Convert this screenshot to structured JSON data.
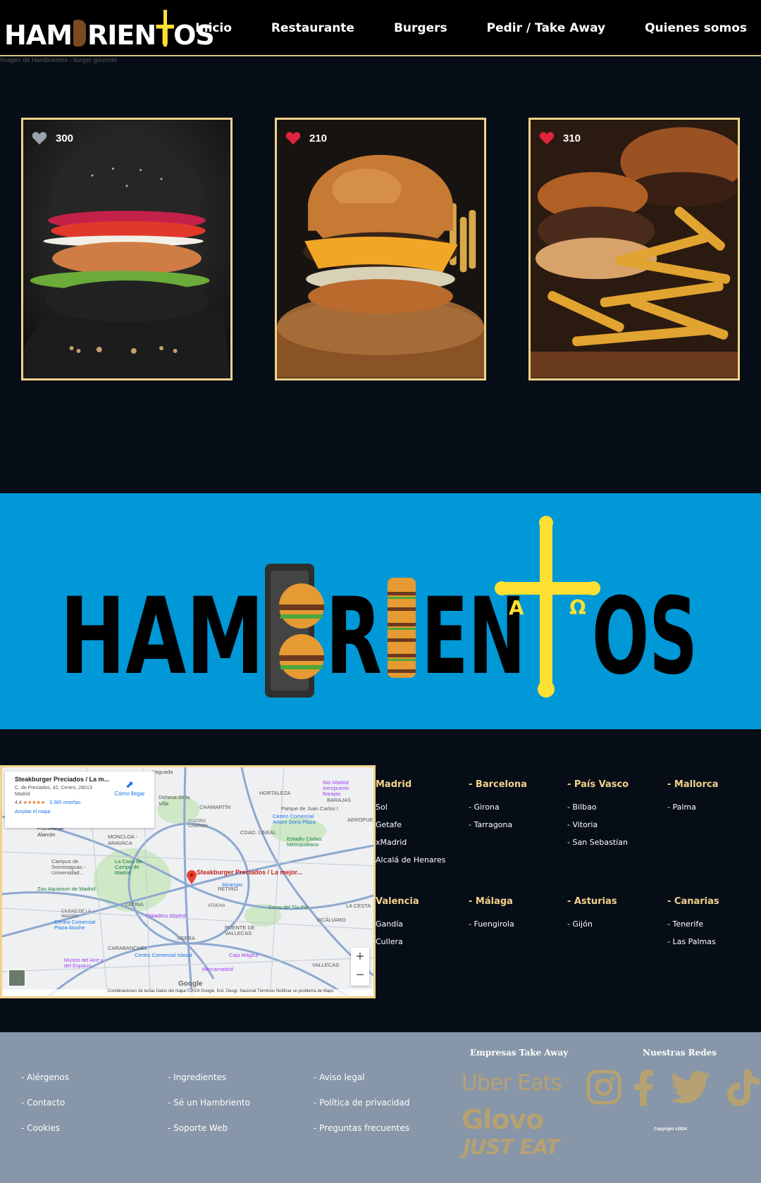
{
  "header": {
    "logo_text": "HAMBRIENTOS",
    "logo_parts": [
      "HAM",
      "RIEN",
      "OS"
    ],
    "nav": [
      "Inicio",
      "Restaurante",
      "Burgers",
      "Pedir / Take Away",
      "Quienes somos"
    ]
  },
  "broken_image_alt": "Imagen de Hambrientos - burger gourmet",
  "cards": [
    {
      "likes": "300",
      "heart": "gray-heart-icon",
      "color": "#9aa3ad"
    },
    {
      "likes": "210",
      "heart": "red-heart-icon",
      "color": "#e0243d"
    },
    {
      "likes": "310",
      "heart": "red-heart-icon",
      "color": "#e0243d"
    }
  ],
  "banner": {
    "logo_parts": [
      "HAM",
      "RIEN",
      "OS"
    ],
    "bg_color": "#0098d6",
    "cross_color": "#ffe033"
  },
  "map": {
    "place_name": "Steakburger Preciados / La m...",
    "address": "C. de Preciados, 42, Centro, 28013 Madrid",
    "rating": "4,4",
    "stars": "★★★★★",
    "reviews": "3.380 reseñas",
    "enlarge": "Ampliar el mapa",
    "directions": "Cómo llegar",
    "pin_label": "Steakburger Preciados / La mejor...",
    "credits": "Combinaciones de teclas   Datos del mapa ©2024 Google, Inst. Geogr. Nacional   Términos   Notificar un problema de Maps",
    "google": "Google",
    "zoom_in": "+",
    "zoom_out": "−",
    "places": [
      "Vaguada",
      "HORTALEZA",
      "Ibis Madrid Aeropuerto Barajas",
      "BARAJAS",
      "Parque de Juan Carlos I",
      "CHAMARTÍN",
      "Dehesa de la Villa",
      "Pozuelo de Alarcón",
      "MONCLOA - ARAVACA",
      "Centro Comercial Arturo Soria Plaza",
      "CDAD. LINEAL",
      "Estadio Civitas Metropolitano",
      "Campus de Somosaguas - Universidad...",
      "La Casa de Campo de Madrid",
      "Zoo Aquarium de Madrid",
      "LATINA",
      "Matadero Madrid",
      "Alcampo",
      "Cerro del Tío Pío",
      "VICÁLVARO",
      "LA CESTA",
      "Centro Comercial Plaza Aluche",
      "USERA",
      "PUENTE DE VALLECAS",
      "CARABANCHEL",
      "Museo del Aire y del Espacio",
      "Centro Comercial Islazul",
      "Caja Mágica",
      "VALLECAS",
      "Mercamadrid",
      "RETIRO",
      "AEROPUERT",
      "CUATRO CAMINOS",
      "CIUDAD DE LA IMAGEN",
      "ATOCHA"
    ]
  },
  "cities": [
    {
      "region": "Madrid",
      "items": [
        "Sol",
        "Getafe",
        "xMadrid",
        "Alcalá de Henares"
      ]
    },
    {
      "region": "- Barcelona",
      "items": [
        "- Girona",
        "- Tarragona"
      ]
    },
    {
      "region": "- País Vasco",
      "items": [
        "- Bilbao",
        "- Vitoria",
        "- San Sebastían"
      ]
    },
    {
      "region": "- Mallorca",
      "items": [
        "- Palma"
      ]
    },
    {
      "region": "Valencia",
      "items": [
        "Gandía",
        "Cullera"
      ]
    },
    {
      "region": "- Málaga",
      "items": [
        "- Fuengirola"
      ]
    },
    {
      "region": "- Asturias",
      "items": [
        "- Gijón"
      ]
    },
    {
      "region": "- Canarias",
      "items": [
        "- Tenerife",
        "- Las Palmas"
      ]
    }
  ],
  "footer": {
    "links_col1": [
      "- Alérgenos",
      "- Contacto",
      "- Cookies"
    ],
    "links_col2": [
      "- Ingredientes",
      "- Sé un Hambriento",
      "- Soporte Web"
    ],
    "links_col3": [
      "- Aviso legal",
      "- Política de privacidad",
      "- Preguntas frecuentes"
    ],
    "takeaway_heading": "Empresas Take Away",
    "takeaway": [
      "Uber Eats",
      "Glovo",
      "JUST EAT"
    ],
    "social_heading": "Nuestras Redes",
    "social_icons": [
      "instagram-icon",
      "facebook-icon",
      "twitter-icon",
      "tiktok-icon"
    ],
    "copyright": "Copyright c2024",
    "accent": "#b6a173"
  }
}
